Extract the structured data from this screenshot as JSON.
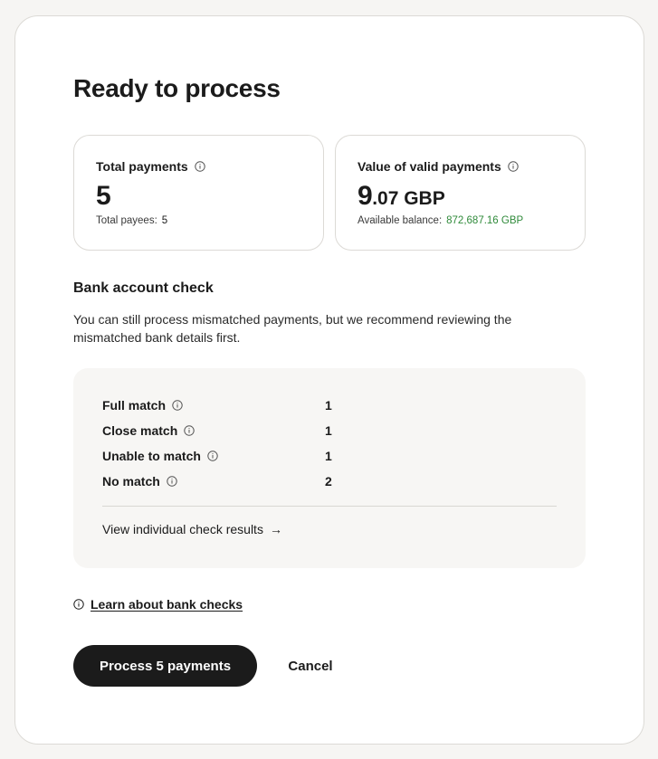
{
  "title": "Ready to process",
  "cards": {
    "total": {
      "label": "Total payments",
      "value": "5",
      "sub_label": "Total payees:",
      "sub_value": "5"
    },
    "valid": {
      "label": "Value of valid payments",
      "value_major": "9",
      "value_minor": ".07 GBP",
      "sub_label": "Available balance:",
      "sub_value": "872,687.16 GBP"
    }
  },
  "bank_check": {
    "title": "Bank account check",
    "description": "You can still process mismatched payments, but we recommend reviewing the mismatched bank details first.",
    "rows": [
      {
        "label": "Full match",
        "count": "1"
      },
      {
        "label": "Close match",
        "count": "1"
      },
      {
        "label": "Unable to match",
        "count": "1"
      },
      {
        "label": "No match",
        "count": "2"
      }
    ],
    "view_link": "View individual check results",
    "arrow": "→"
  },
  "learn_link": "Learn about bank checks",
  "actions": {
    "process": "Process 5 payments",
    "cancel": "Cancel"
  },
  "colors": {
    "accent_green": "#2f8a3a",
    "primary_button": "#1b1b1b",
    "panel_bg": "#f7f6f4"
  },
  "icons": {
    "info": "info-icon",
    "arrow": "arrow-right-icon"
  }
}
